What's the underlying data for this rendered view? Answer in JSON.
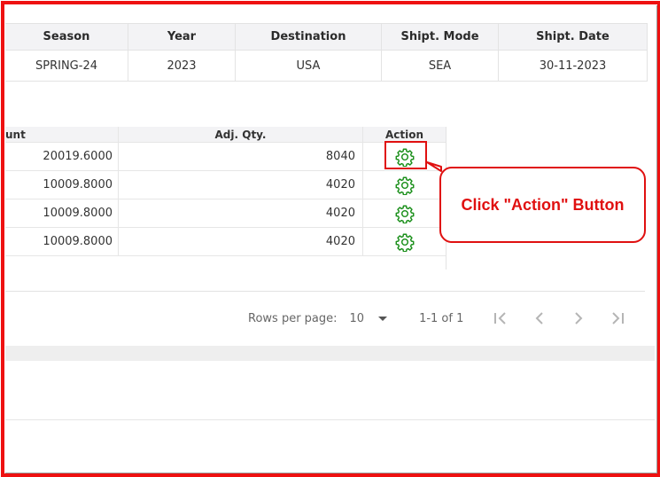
{
  "top_table": {
    "headers": [
      "Season",
      "Year",
      "Destination",
      "Shipt. Mode",
      "Shipt. Date"
    ],
    "row": [
      "SPRING-24",
      "2023",
      "USA",
      "SEA",
      "30-11-2023"
    ]
  },
  "inner_table": {
    "headers": [
      "unt",
      "Adj. Qty.",
      "Action"
    ],
    "rows": [
      {
        "amount": "20019.6000",
        "adj_qty": "8040"
      },
      {
        "amount": "10009.8000",
        "adj_qty": "4020"
      },
      {
        "amount": "10009.8000",
        "adj_qty": "4020"
      },
      {
        "amount": "10009.8000",
        "adj_qty": "4020"
      }
    ]
  },
  "callout": {
    "text": "Click \"Action\" Button"
  },
  "pagination": {
    "rows_per_page_label": "Rows per page:",
    "rows_per_page_value": "10",
    "range": "1-1 of 1"
  },
  "colors": {
    "annotation_red": "#e01010",
    "gear_green": "#1a8f1a"
  },
  "icons": [
    "gear-icon",
    "first-page-icon",
    "prev-page-icon",
    "next-page-icon",
    "last-page-icon",
    "chevron-down-icon"
  ]
}
